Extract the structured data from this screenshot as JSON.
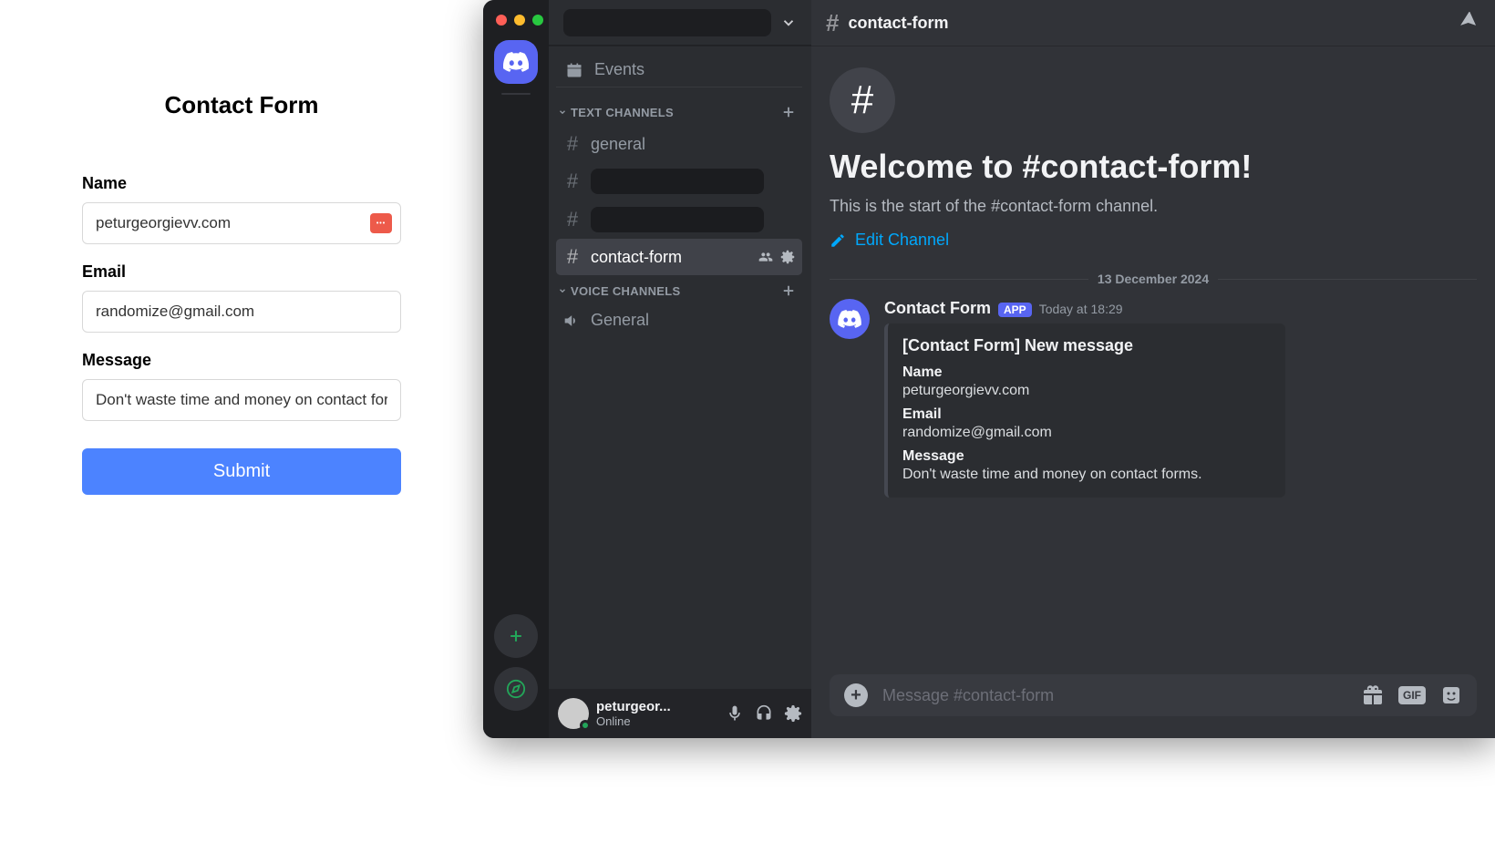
{
  "form": {
    "title": "Contact Form",
    "name_label": "Name",
    "name_value": "peturgeorgievv.com",
    "email_label": "Email",
    "email_value": "randomize@gmail.com",
    "message_label": "Message",
    "message_value": "Don't waste time and money on contact forms.",
    "submit_label": "Submit"
  },
  "discord": {
    "events_label": "Events",
    "text_channels_label": "TEXT CHANNELS",
    "voice_channels_label": "VOICE CHANNELS",
    "channels": {
      "general": "general",
      "contact_form": "contact-form",
      "voice_general": "General"
    },
    "user": {
      "name": "peturgeor...",
      "status": "Online"
    },
    "header_channel": "contact-form",
    "welcome_title": "Welcome to #contact-form!",
    "welcome_sub": "This is the start of the #contact-form channel.",
    "edit_channel": "Edit Channel",
    "date_divider": "13 December 2024",
    "message": {
      "author": "Contact Form",
      "app_tag": "APP",
      "timestamp": "Today at 18:29",
      "embed_title": "[Contact Form] New message",
      "fields": {
        "name_label": "Name",
        "name_value": "peturgeorgievv.com",
        "email_label": "Email",
        "email_value": "randomize@gmail.com",
        "message_label": "Message",
        "message_value": "Don't waste time and money on contact forms."
      }
    },
    "composer_placeholder": "Message #contact-form"
  }
}
